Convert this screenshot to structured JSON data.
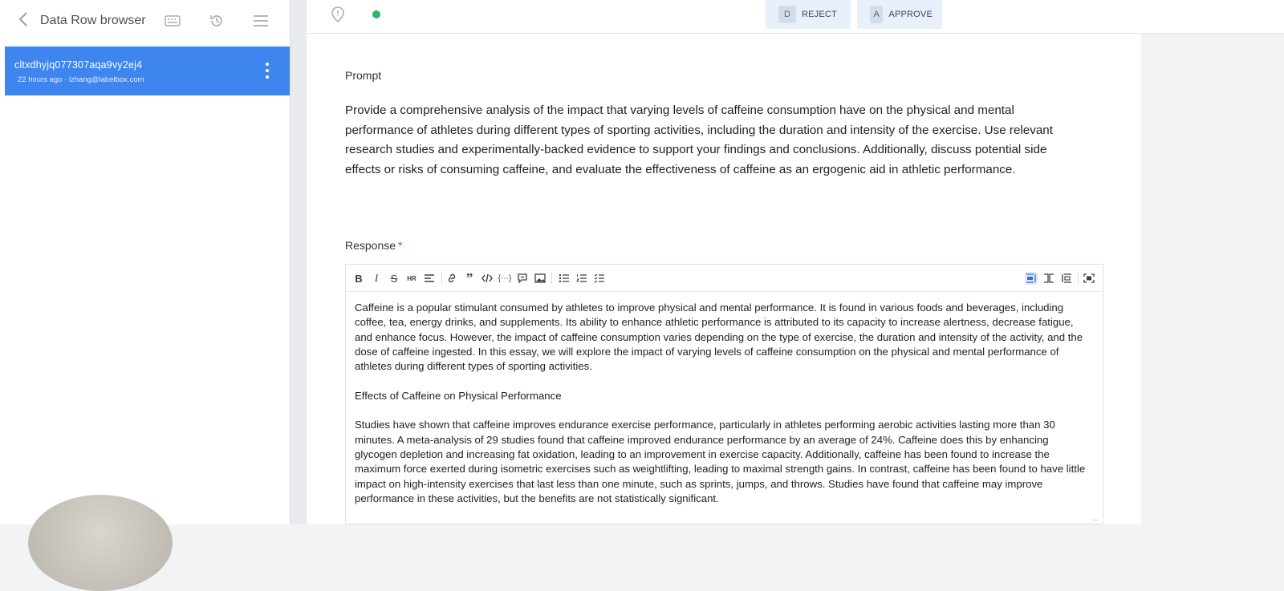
{
  "sidebar": {
    "title": "Data Row browser",
    "row": {
      "id": "cltxdhyjq077307aqa9vy2ej4",
      "meta": "22 hours ago · lzhang@labelbox.com"
    }
  },
  "topbar": {
    "reject": {
      "key": "D",
      "label": "REJECT"
    },
    "approve": {
      "key": "A",
      "label": "APPROVE"
    }
  },
  "main": {
    "prompt_label": "Prompt",
    "prompt_text": "Provide a comprehensive analysis of the impact that varying levels of caffeine consumption have on the physical and mental performance of athletes during different types of sporting activities, including the duration and intensity of the exercise. Use relevant research studies and experimentally-backed evidence to support your findings and conclusions. Additionally, discuss potential side effects or risks of consuming caffeine, and evaluate the effectiveness of caffeine as an ergogenic aid in athletic performance.",
    "response_label": "Response",
    "required_mark": "*",
    "response_paragraphs": [
      "Caffeine is a popular stimulant consumed by athletes to improve physical and mental performance. It is found in various foods and beverages, including coffee, tea, energy drinks, and supplements. Its ability to enhance athletic performance is attributed to its capacity to increase alertness, decrease fatigue, and enhance focus. However, the impact of caffeine consumption varies depending on the type of exercise, the duration and intensity of the activity, and the dose of caffeine ingested. In this essay, we will explore the impact of varying levels of caffeine consumption on the physical and mental performance of athletes during different types of sporting activities.",
      "Effects of Caffeine on Physical Performance",
      "Studies have shown that caffeine improves endurance exercise performance, particularly in athletes performing aerobic activities lasting more than 30 minutes. A meta-analysis of 29 studies found that caffeine improved endurance performance by an average of 24%. Caffeine does this by enhancing glycogen depletion and increasing fat oxidation, leading to an improvement in exercise capacity. Additionally, caffeine has been found to increase the maximum force exerted during isometric exercises such as weightlifting, leading to maximal strength gains. In contrast, caffeine has been found to have little impact on high-intensity exercises that last less than one minute, such as sprints, jumps, and throws. Studies have found that caffeine may improve performance in these activities, but the benefits are not statistically significant."
    ],
    "resize_handle": "..."
  },
  "icons": {
    "back": "chevron-left-icon",
    "keyboard": "keyboard-icon",
    "history": "history-icon",
    "menu": "hamburger-menu-icon"
  },
  "colors": {
    "accent": "#3f85ef",
    "status": "#2fb36a",
    "required": "#d93a3a"
  }
}
